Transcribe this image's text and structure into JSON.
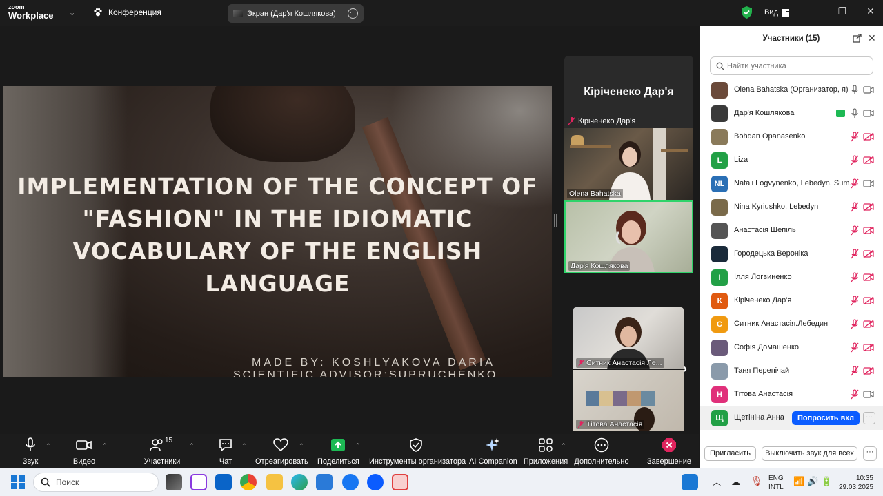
{
  "titlebar": {
    "brand_line1": "zoom",
    "brand_line2": "Workplace",
    "meeting_label": "Конференция",
    "screen_share_label": "Экран (Дар'я Кошлякова)",
    "view_label": "Вид"
  },
  "slide": {
    "title_lines": [
      "IMPLEMENTATION OF THE CONCEPT OF",
      "\"FASHION\" IN THE IDIOMATIC",
      "VOCABULARY OF THE ENGLISH",
      "LANGUAGE"
    ],
    "made_by": "MADE BY: KOSHLYAKOVA DARIA",
    "advisor": "SCIENTIFIC ADVISOR:SUPRUCHENKO"
  },
  "gallery": {
    "name_card_big": "Кіріченеко Дар'я",
    "name_card_small": "Кіріченеко Дар'я",
    "tile1_label": "Olena Bahatska",
    "tile2_label": "Дар'я Кошлякова",
    "tile3_label": "Ситник Анастасія.Ле...",
    "tile4_label": "Тітова Анастасія"
  },
  "toolbar": {
    "audio": "Звук",
    "video": "Видео",
    "participants": "Участники",
    "participants_count": "15",
    "chat": "Чат",
    "react": "Отреагировать",
    "share": "Поделиться",
    "host_tools": "Инструменты организатора",
    "ai": "AI Companion",
    "apps": "Приложения",
    "more": "Дополнительно",
    "end": "Завершение"
  },
  "panel": {
    "title": "Участники (15)",
    "search_placeholder": "Найти участника",
    "participants": [
      {
        "name": "Olena Bahatska (Организатор, я)",
        "avatar_text": "",
        "avatar_color": "#6b4a3a",
        "mic": "on",
        "cam": "on"
      },
      {
        "name": "Дар'я Кошлякова",
        "avatar_text": "",
        "avatar_color": "#3a3a3a",
        "mic": "on",
        "cam": "on"
      },
      {
        "name": "Bohdan Opanasenko",
        "avatar_text": "",
        "avatar_color": "#8a7a5a",
        "mic": "off",
        "cam": "off"
      },
      {
        "name": "Liza",
        "avatar_text": "L",
        "avatar_color": "#22a046",
        "mic": "off",
        "cam": "off"
      },
      {
        "name": "Natali Logvynenko, Lebedyn, Sum...",
        "avatar_text": "NL",
        "avatar_color": "#2a6fb5",
        "mic": "off",
        "cam": "on"
      },
      {
        "name": "Nina Kyriushko, Lebedyn",
        "avatar_text": "",
        "avatar_color": "#7a6a4a",
        "mic": "off",
        "cam": "off"
      },
      {
        "name": "Анастасія Шепіль",
        "avatar_text": "",
        "avatar_color": "#555555",
        "mic": "off",
        "cam": "off"
      },
      {
        "name": "Городецька Вероніка",
        "avatar_text": "",
        "avatar_color": "#1a2a3a",
        "mic": "off",
        "cam": "off"
      },
      {
        "name": "Ілля Логвиненко",
        "avatar_text": "І",
        "avatar_color": "#22a046",
        "mic": "off",
        "cam": "off"
      },
      {
        "name": "Кіріченеко Дар'я",
        "avatar_text": "К",
        "avatar_color": "#e05a10",
        "mic": "off",
        "cam": "off"
      },
      {
        "name": "Ситник Анастасія.Лебедин",
        "avatar_text": "С",
        "avatar_color": "#f09a10",
        "mic": "off",
        "cam": "off"
      },
      {
        "name": "Софія Домашенко",
        "avatar_text": "",
        "avatar_color": "#6a5a7a",
        "mic": "off",
        "cam": "off"
      },
      {
        "name": "Таня Перепічай",
        "avatar_text": "",
        "avatar_color": "#8a9aaa",
        "mic": "off",
        "cam": "off"
      },
      {
        "name": "Тітова Анастасія",
        "avatar_text": "Н",
        "avatar_color": "#e0307a",
        "mic": "off",
        "cam": "on"
      },
      {
        "name": "Щетініна Анна",
        "avatar_text": "Щ",
        "avatar_color": "#22a046",
        "mic": "none",
        "cam": "none"
      }
    ],
    "ask_unmute_label": "Попросить вкл",
    "invite_label": "Пригласить",
    "mute_all_label": "Выключить звук для всех"
  },
  "taskbar": {
    "search_placeholder": "Поиск",
    "lang1": "ENG",
    "lang2": "INTL",
    "time": "10:35",
    "date": "29.03.2025"
  },
  "colors": {
    "accent_blue": "#0b5cff",
    "active_speaker": "#2fd36a",
    "muted_red": "#e0245e",
    "share_green": "#1db954"
  }
}
